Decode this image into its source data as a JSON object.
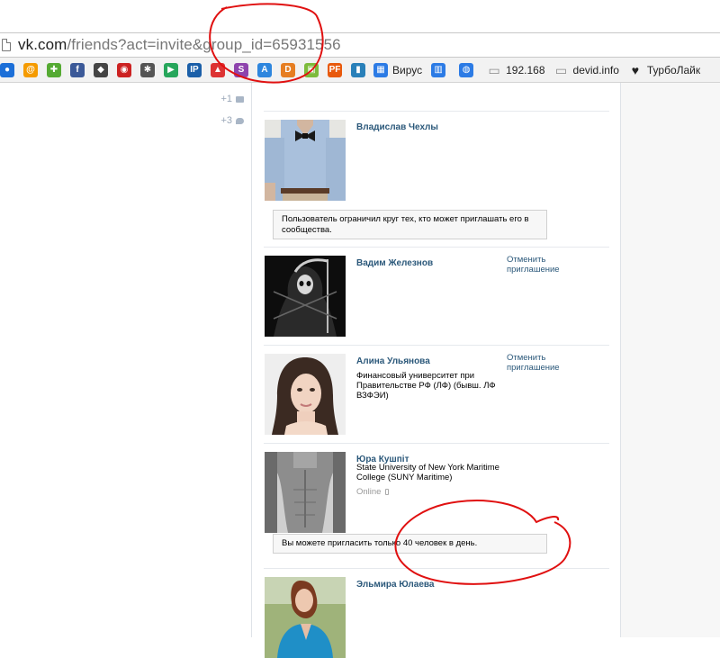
{
  "browser": {
    "url_host": "vk.com",
    "url_path": "/friends?act=invite&group_id=65931556",
    "bookmarks": [
      {
        "icon": "circle-blue-icon",
        "color": "#1c6fd8",
        "glyph": "●"
      },
      {
        "icon": "at-icon",
        "color": "#f59b00",
        "glyph": "@"
      },
      {
        "icon": "puzzle-icon",
        "color": "#55aa33",
        "glyph": "✚"
      },
      {
        "icon": "facebook-icon",
        "color": "#3b5998",
        "glyph": "f"
      },
      {
        "icon": "shield-game-icon",
        "color": "#444444",
        "glyph": "◆"
      },
      {
        "icon": "spiral-icon",
        "color": "#cc2222",
        "glyph": "◉"
      },
      {
        "icon": "bug-icon",
        "color": "#555555",
        "glyph": "✱"
      },
      {
        "icon": "play-store-icon",
        "color": "#26a65b",
        "glyph": "▶"
      },
      {
        "icon": "ip-icon",
        "color": "#1b5fa8",
        "glyph": "IP"
      },
      {
        "icon": "warning-icon",
        "color": "#dd3333",
        "glyph": "▲"
      },
      {
        "icon": "s-icon",
        "color": "#8e44ad",
        "glyph": "S"
      },
      {
        "icon": "translate-icon",
        "color": "#2e86de",
        "glyph": "A"
      },
      {
        "icon": "dyfly-icon",
        "color": "#e67e22",
        "glyph": "D"
      },
      {
        "icon": "image-edit-icon",
        "color": "#7dbb3c",
        "glyph": "▣"
      },
      {
        "icon": "pf-icon",
        "color": "#e8590c",
        "glyph": "PF"
      },
      {
        "icon": "bar-chart-icon",
        "color": "#2980b9",
        "glyph": "▮"
      }
    ],
    "named_bookmarks": [
      {
        "icon": "virus-icon",
        "label": "Вирус",
        "color": "#2c7be5",
        "glyph": "▦"
      },
      {
        "icon": "document-icon",
        "label": "",
        "color": "#2c7be5",
        "glyph": "▥"
      },
      {
        "icon": "globe-icon",
        "label": "",
        "color": "#2c7be5",
        "glyph": "◍"
      },
      {
        "icon": "page-icon",
        "label": "192.168",
        "color": "#8a8a8a",
        "glyph": "▭"
      },
      {
        "icon": "page-icon",
        "label": "devid.info",
        "color": "#8a8a8a",
        "glyph": "▭"
      },
      {
        "icon": "heart-icon",
        "label": "ТурбоЛайк",
        "color": "#222222",
        "glyph": "♥"
      }
    ]
  },
  "sidebar": {
    "counters": [
      {
        "value": "+1",
        "icon": "mail-icon"
      },
      {
        "value": "+3",
        "icon": "comment-icon"
      }
    ]
  },
  "friends": [
    {
      "name": "Владислав Чехлы",
      "info": "",
      "online": "",
      "cancel_label": "",
      "note": "Пользователь ограничил круг тех, кто может приглашать его в сообщества.",
      "photo": "man-shirt-bowtie"
    },
    {
      "name": "Вадим Железнов",
      "info": "",
      "online": "",
      "cancel_label": "Отменить приглашение",
      "note": "",
      "photo": "grim-reaper"
    },
    {
      "name": "Алина Ульянова",
      "info": "Финансовый университет при Правительстве РФ (ЛФ) (бывш. ЛФ ВЗФЭИ)",
      "online": "",
      "cancel_label": "Отменить приглашение",
      "note": "",
      "photo": "woman-dark-hair"
    },
    {
      "name": "Юра Кушпіт",
      "info": "State University of New York Maritime College (SUNY Maritime)",
      "online": "Online",
      "cancel_label": "",
      "note": "Вы можете пригласить только 40 человек в день.",
      "photo": "man-torso-bw"
    },
    {
      "name": "Эльмира Юлаева",
      "info": "",
      "online": "",
      "cancel_label": "",
      "note": "",
      "photo": "woman-blue-jacket"
    }
  ],
  "colors": {
    "link": "#2b587a",
    "annotation": "#e01010"
  }
}
